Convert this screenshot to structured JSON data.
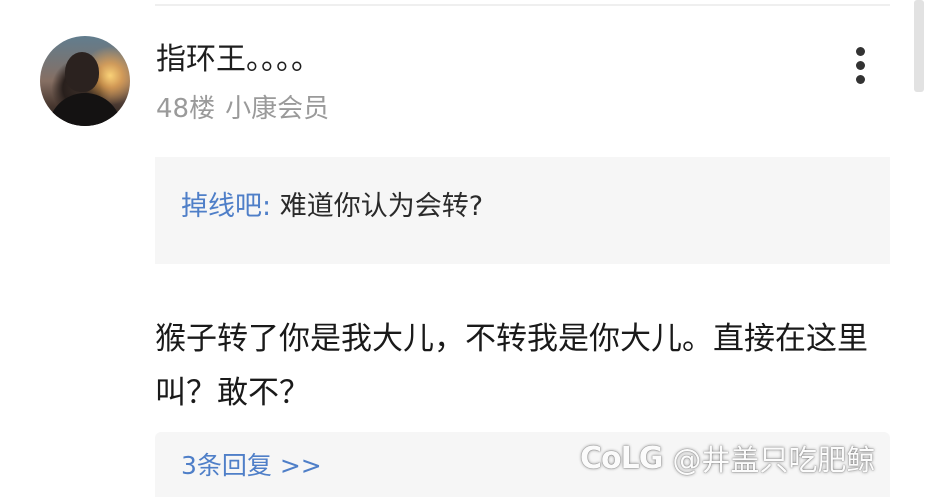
{
  "comment": {
    "username": "指环王。。。。",
    "floor": "48楼",
    "member_level": "小康会员",
    "quote": {
      "author": "掉线吧:",
      "text": "难道你认为会转?"
    },
    "content": "猴子转了你是我大儿，不转我是你大儿。直接在这里叫？敢不？",
    "replies_label": "3条回复 >>"
  },
  "watermark": {
    "logo": "CoLG",
    "handle": "@井盖只吃肥鲸"
  },
  "icons": {
    "avatar": "user-avatar",
    "more": "more-vertical-icon"
  }
}
